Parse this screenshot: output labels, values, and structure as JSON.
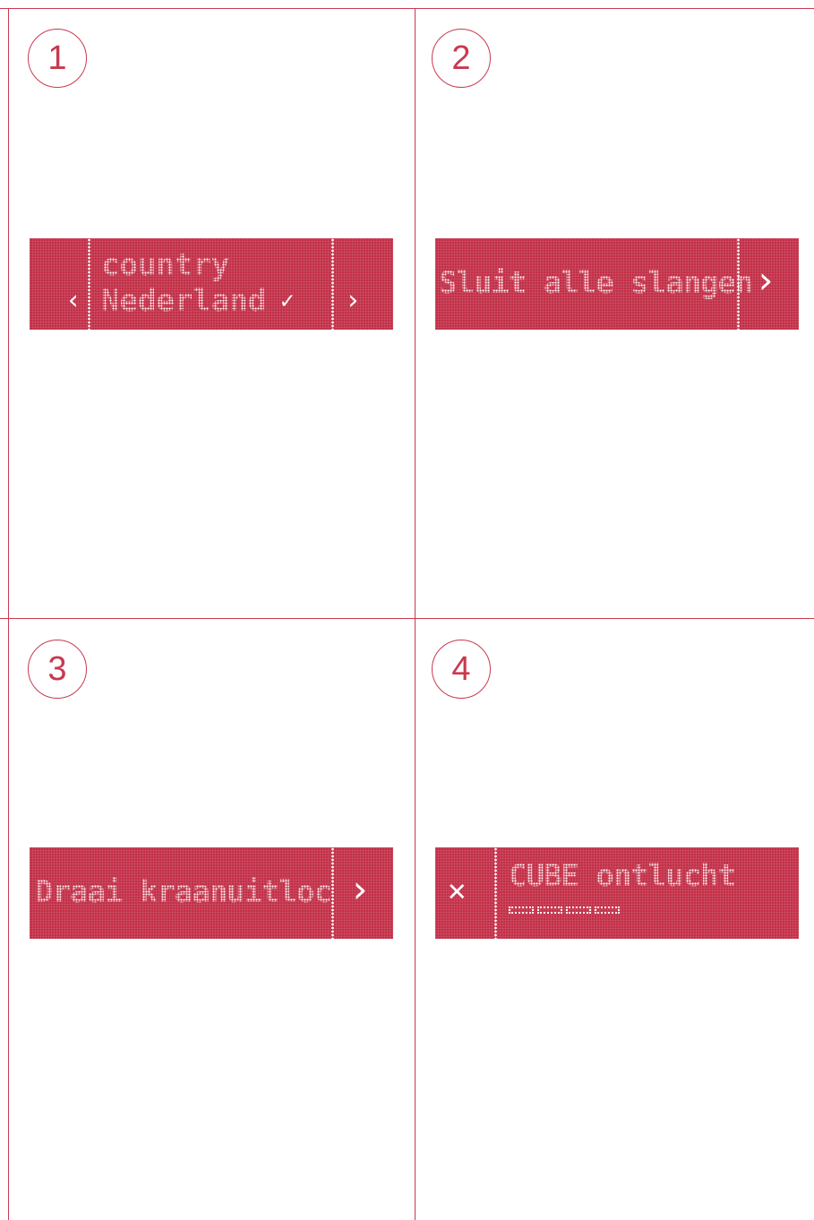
{
  "panels": [
    {
      "number": "1",
      "line1": "country",
      "line2": "Nederland",
      "check_icon": "check-icon",
      "left_icon": "chevron-left-icon",
      "right_icon": "chevron-right-icon"
    },
    {
      "number": "2",
      "text": "Sluit alle slangen",
      "right_icon": "chevron-right-icon"
    },
    {
      "number": "3",
      "text": "Draai kraanuitloc",
      "right_icon": "chevron-right-icon"
    },
    {
      "number": "4",
      "text": "CUBE ontlucht",
      "left_icon": "close-icon",
      "progress_segments": 4
    }
  ],
  "colors": {
    "accent": "#c22f47",
    "line": "#c9394f",
    "lcd_text": "#ffffff"
  }
}
